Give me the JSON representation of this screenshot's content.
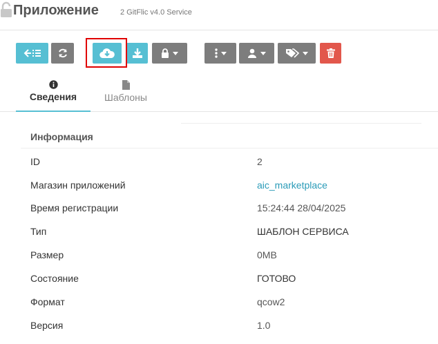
{
  "header": {
    "title": "Приложение",
    "subtitle": "2 GitFlic v4.0 Service"
  },
  "toolbar": {
    "buttons": [
      {
        "name": "back-list-button",
        "icon": "arrow-left-list-icon",
        "color": "#56bfd3"
      },
      {
        "name": "refresh-button",
        "icon": "refresh-icon",
        "color": "#7d7d7d"
      },
      {
        "name": "cloud-download-button",
        "icon": "cloud-download-icon",
        "color": "#56bfd3"
      },
      {
        "name": "download-button",
        "icon": "download-icon",
        "color": "#56bfd3"
      },
      {
        "name": "lock-dropdown-button",
        "icon": "lock-icon",
        "color": "#7d7d7d"
      },
      {
        "name": "more-dropdown-button",
        "icon": "vertical-dots-icon",
        "color": "#7d7d7d"
      },
      {
        "name": "user-dropdown-button",
        "icon": "user-icon",
        "color": "#7d7d7d"
      },
      {
        "name": "tags-dropdown-button",
        "icon": "tags-icon",
        "color": "#7d7d7d"
      },
      {
        "name": "delete-button",
        "icon": "trash-icon",
        "color": "#e2574c"
      }
    ],
    "highlight_color": "#e00000"
  },
  "tabs": [
    {
      "label": "Сведения",
      "icon": "info-circle-icon",
      "active": true
    },
    {
      "label": "Шаблоны",
      "icon": "file-icon",
      "active": false
    }
  ],
  "section": {
    "title": "Информация"
  },
  "details": [
    {
      "key": "ID",
      "value": "2"
    },
    {
      "key": "Магазин приложений",
      "value": "aic_marketplace"
    },
    {
      "key": "Время регистрации",
      "value": "15:24:44 28/04/2025"
    },
    {
      "key": "Тип",
      "value": "ШАБЛОН СЕРВИСА"
    },
    {
      "key": "Размер",
      "value": "0MB"
    },
    {
      "key": "Состояние",
      "value": "ГОТОВО"
    },
    {
      "key": "Формат",
      "value": "qcow2"
    },
    {
      "key": "Версия",
      "value": "1.0"
    }
  ],
  "colors": {
    "accent": "#56bfd3",
    "link": "#2a9bb8",
    "danger": "#e2574c",
    "neutral": "#7d7d7d"
  }
}
